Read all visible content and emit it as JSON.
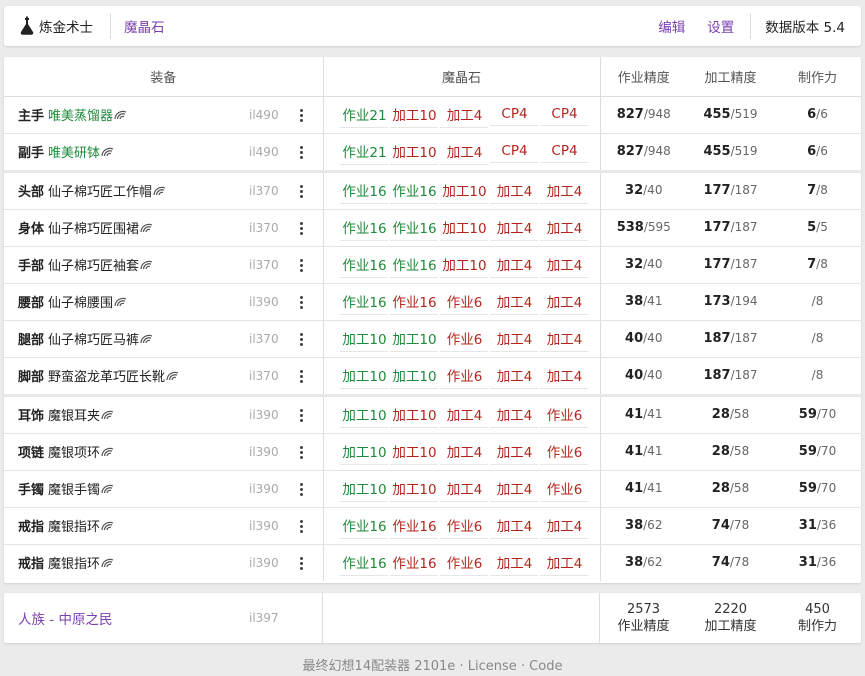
{
  "topbar": {
    "title": "炼金术士",
    "crumb": "魔晶石",
    "links": [
      "编辑",
      "设置"
    ],
    "version": "数据版本 5.4"
  },
  "table": {
    "headers": [
      "装备",
      "魔晶石",
      "作业精度",
      "加工精度",
      "制作力"
    ],
    "rows": [
      {
        "slot": "主手",
        "name": "唯美蒸馏器",
        "color": "green",
        "ilvl": "il490",
        "materia": [
          {
            "t": "作业21",
            "c": "green"
          },
          {
            "t": "加工10",
            "c": "red"
          },
          {
            "t": "加工4",
            "c": "red"
          },
          {
            "t": "CP4",
            "c": "red"
          },
          {
            "t": "CP4",
            "c": "red"
          }
        ],
        "s1": "827",
        "s1max": "/948",
        "s2": "455",
        "s2max": "/519",
        "s3": "6",
        "s3max": "/6",
        "group": false
      },
      {
        "slot": "副手",
        "name": "唯美研钵",
        "color": "green",
        "ilvl": "il490",
        "materia": [
          {
            "t": "作业21",
            "c": "green"
          },
          {
            "t": "加工10",
            "c": "red"
          },
          {
            "t": "加工4",
            "c": "red"
          },
          {
            "t": "CP4",
            "c": "red"
          },
          {
            "t": "CP4",
            "c": "red"
          }
        ],
        "s1": "827",
        "s1max": "/948",
        "s2": "455",
        "s2max": "/519",
        "s3": "6",
        "s3max": "/6",
        "group": false
      },
      {
        "slot": "头部",
        "name": "仙子棉巧匠工作帽",
        "color": "dark",
        "ilvl": "il370",
        "materia": [
          {
            "t": "作业16",
            "c": "green"
          },
          {
            "t": "作业16",
            "c": "green"
          },
          {
            "t": "加工10",
            "c": "red"
          },
          {
            "t": "加工4",
            "c": "red"
          },
          {
            "t": "加工4",
            "c": "red"
          }
        ],
        "s1": "32",
        "s1max": "/40",
        "s2": "177",
        "s2max": "/187",
        "s3": "7",
        "s3max": "/8",
        "group": true
      },
      {
        "slot": "身体",
        "name": "仙子棉巧匠围裙",
        "color": "dark",
        "ilvl": "il370",
        "materia": [
          {
            "t": "作业16",
            "c": "green"
          },
          {
            "t": "作业16",
            "c": "green"
          },
          {
            "t": "加工10",
            "c": "red"
          },
          {
            "t": "加工4",
            "c": "red"
          },
          {
            "t": "加工4",
            "c": "red"
          }
        ],
        "s1": "538",
        "s1max": "/595",
        "s2": "177",
        "s2max": "/187",
        "s3": "5",
        "s3max": "/5",
        "group": false
      },
      {
        "slot": "手部",
        "name": "仙子棉巧匠袖套",
        "color": "dark",
        "ilvl": "il370",
        "materia": [
          {
            "t": "作业16",
            "c": "green"
          },
          {
            "t": "作业16",
            "c": "green"
          },
          {
            "t": "加工10",
            "c": "red"
          },
          {
            "t": "加工4",
            "c": "red"
          },
          {
            "t": "加工4",
            "c": "red"
          }
        ],
        "s1": "32",
        "s1max": "/40",
        "s2": "177",
        "s2max": "/187",
        "s3": "7",
        "s3max": "/8",
        "group": false
      },
      {
        "slot": "腰部",
        "name": "仙子棉腰围",
        "color": "dark",
        "ilvl": "il390",
        "materia": [
          {
            "t": "作业16",
            "c": "green"
          },
          {
            "t": "作业16",
            "c": "red"
          },
          {
            "t": "作业6",
            "c": "red"
          },
          {
            "t": "加工4",
            "c": "red"
          },
          {
            "t": "加工4",
            "c": "red"
          }
        ],
        "s1": "38",
        "s1max": "/41",
        "s2": "173",
        "s2max": "/194",
        "s3": "",
        "s3max": "/8",
        "group": false
      },
      {
        "slot": "腿部",
        "name": "仙子棉巧匠马裤",
        "color": "dark",
        "ilvl": "il370",
        "materia": [
          {
            "t": "加工10",
            "c": "green"
          },
          {
            "t": "加工10",
            "c": "green"
          },
          {
            "t": "作业6",
            "c": "red"
          },
          {
            "t": "加工4",
            "c": "red"
          },
          {
            "t": "加工4",
            "c": "red"
          }
        ],
        "s1": "40",
        "s1max": "/40",
        "s2": "187",
        "s2max": "/187",
        "s3": "",
        "s3max": "/8",
        "group": false
      },
      {
        "slot": "脚部",
        "name": "野蛮盗龙革巧匠长靴",
        "color": "dark",
        "ilvl": "il370",
        "materia": [
          {
            "t": "加工10",
            "c": "green"
          },
          {
            "t": "加工10",
            "c": "green"
          },
          {
            "t": "作业6",
            "c": "red"
          },
          {
            "t": "加工4",
            "c": "red"
          },
          {
            "t": "加工4",
            "c": "red"
          }
        ],
        "s1": "40",
        "s1max": "/40",
        "s2": "187",
        "s2max": "/187",
        "s3": "",
        "s3max": "/8",
        "group": false
      },
      {
        "slot": "耳饰",
        "name": "魔银耳夹",
        "color": "dark",
        "ilvl": "il390",
        "materia": [
          {
            "t": "加工10",
            "c": "green"
          },
          {
            "t": "加工10",
            "c": "red"
          },
          {
            "t": "加工4",
            "c": "red"
          },
          {
            "t": "加工4",
            "c": "red"
          },
          {
            "t": "作业6",
            "c": "red"
          }
        ],
        "s1": "41",
        "s1max": "/41",
        "s2": "28",
        "s2max": "/58",
        "s3": "59",
        "s3max": "/70",
        "group": true
      },
      {
        "slot": "项链",
        "name": "魔银项环",
        "color": "dark",
        "ilvl": "il390",
        "materia": [
          {
            "t": "加工10",
            "c": "green"
          },
          {
            "t": "加工10",
            "c": "red"
          },
          {
            "t": "加工4",
            "c": "red"
          },
          {
            "t": "加工4",
            "c": "red"
          },
          {
            "t": "作业6",
            "c": "red"
          }
        ],
        "s1": "41",
        "s1max": "/41",
        "s2": "28",
        "s2max": "/58",
        "s3": "59",
        "s3max": "/70",
        "group": false
      },
      {
        "slot": "手镯",
        "name": "魔银手镯",
        "color": "dark",
        "ilvl": "il390",
        "materia": [
          {
            "t": "加工10",
            "c": "green"
          },
          {
            "t": "加工10",
            "c": "red"
          },
          {
            "t": "加工4",
            "c": "red"
          },
          {
            "t": "加工4",
            "c": "red"
          },
          {
            "t": "作业6",
            "c": "red"
          }
        ],
        "s1": "41",
        "s1max": "/41",
        "s2": "28",
        "s2max": "/58",
        "s3": "59",
        "s3max": "/70",
        "group": false
      },
      {
        "slot": "戒指",
        "name": "魔银指环",
        "color": "dark",
        "ilvl": "il390",
        "materia": [
          {
            "t": "作业16",
            "c": "green"
          },
          {
            "t": "作业16",
            "c": "red"
          },
          {
            "t": "作业6",
            "c": "red"
          },
          {
            "t": "加工4",
            "c": "red"
          },
          {
            "t": "加工4",
            "c": "red"
          }
        ],
        "s1": "38",
        "s1max": "/62",
        "s2": "74",
        "s2max": "/78",
        "s3": "31",
        "s3max": "/36",
        "group": false
      },
      {
        "slot": "戒指",
        "name": "魔银指环",
        "color": "dark",
        "ilvl": "il390",
        "materia": [
          {
            "t": "作业16",
            "c": "green"
          },
          {
            "t": "作业16",
            "c": "red"
          },
          {
            "t": "作业6",
            "c": "red"
          },
          {
            "t": "加工4",
            "c": "red"
          },
          {
            "t": "加工4",
            "c": "red"
          }
        ],
        "s1": "38",
        "s1max": "/62",
        "s2": "74",
        "s2max": "/78",
        "s3": "31",
        "s3max": "/36",
        "group": false
      }
    ]
  },
  "race": {
    "name": "人族 - 中原之民",
    "ilvl": "il397",
    "totals": [
      {
        "value": "2573",
        "label": "作业精度"
      },
      {
        "value": "2220",
        "label": "加工精度"
      },
      {
        "value": "450",
        "label": "制作力"
      }
    ]
  },
  "footer": {
    "text": "最终幻想14配装器 2101e",
    "dot": "·",
    "license": "License",
    "code": "Code"
  },
  "colors": {
    "accent": "#7a3fb0",
    "green": "#1f8a3b",
    "red": "#b3261e"
  },
  "icons": {
    "brand": "alchemist-flask-icon",
    "hq": "hq-icon",
    "menu": "kebab-menu-icon"
  }
}
